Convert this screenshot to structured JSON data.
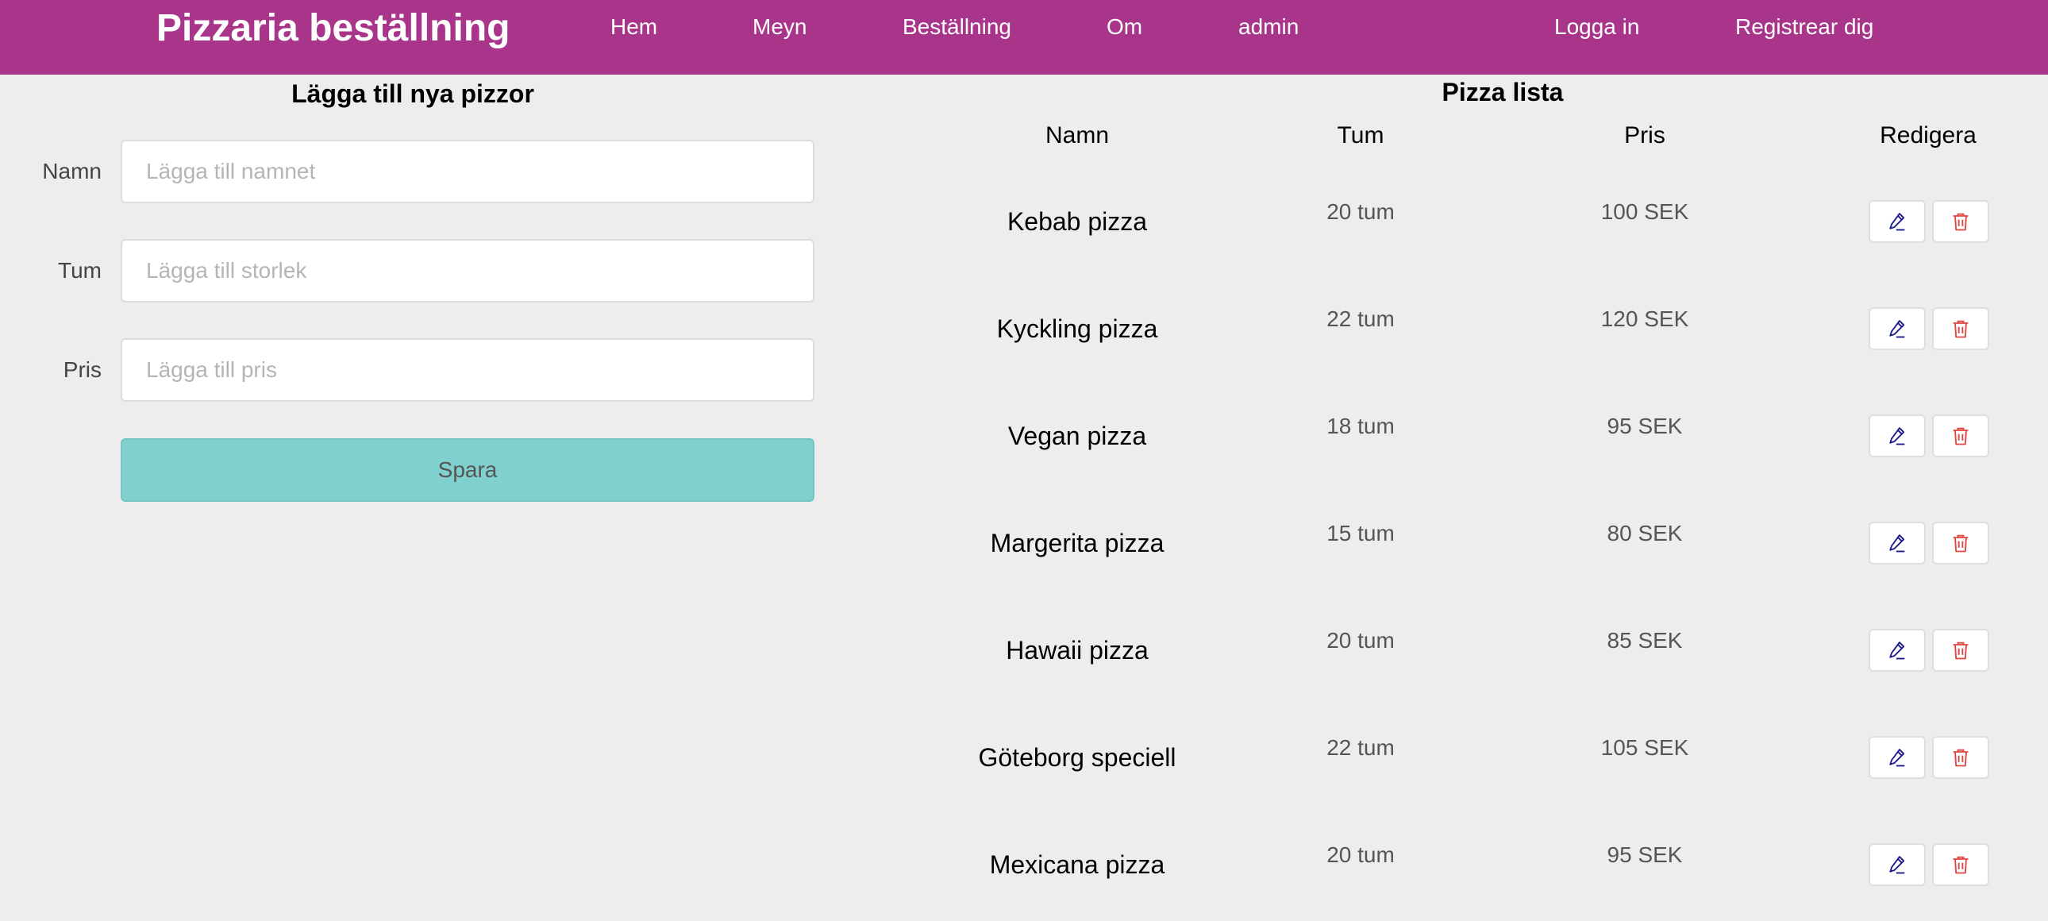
{
  "navbar": {
    "brand": "Pizzaria beställning",
    "links": [
      "Hem",
      "Meyn",
      "Beställning",
      "Om",
      "admin"
    ],
    "auth": [
      "Logga in",
      "Registrear dig"
    ]
  },
  "form": {
    "title": "Lägga till nya pizzor",
    "fields": [
      {
        "label": "Namn",
        "placeholder": "Lägga till namnet",
        "value": ""
      },
      {
        "label": "Tum",
        "placeholder": "Lägga till storlek",
        "value": ""
      },
      {
        "label": "Pris",
        "placeholder": "Lägga till pris",
        "value": ""
      }
    ],
    "save_label": "Spara"
  },
  "list": {
    "title": "Pizza lista",
    "columns": [
      "Namn",
      "Tum",
      "Pris",
      "Redigera"
    ],
    "rows": [
      {
        "name": "Kebab pizza",
        "size": "20 tum",
        "price": "100 SEK"
      },
      {
        "name": "Kyckling pizza",
        "size": "22 tum",
        "price": "120 SEK"
      },
      {
        "name": "Vegan pizza",
        "size": "18 tum",
        "price": "95 SEK"
      },
      {
        "name": "Margerita pizza",
        "size": "15 tum",
        "price": "80 SEK"
      },
      {
        "name": "Hawaii pizza",
        "size": "20 tum",
        "price": "85 SEK"
      },
      {
        "name": "Göteborg speciell",
        "size": "22 tum",
        "price": "105 SEK"
      },
      {
        "name": "Mexicana pizza",
        "size": "20 tum",
        "price": "95 SEK"
      }
    ],
    "edit_icon": "pencil-icon",
    "delete_icon": "trash-icon"
  },
  "colors": {
    "navbar": "#a8358a",
    "background": "#ededed",
    "save_button": "#80d0cf",
    "edit_icon": "#1a1a8c",
    "delete_icon": "#e0453f"
  }
}
